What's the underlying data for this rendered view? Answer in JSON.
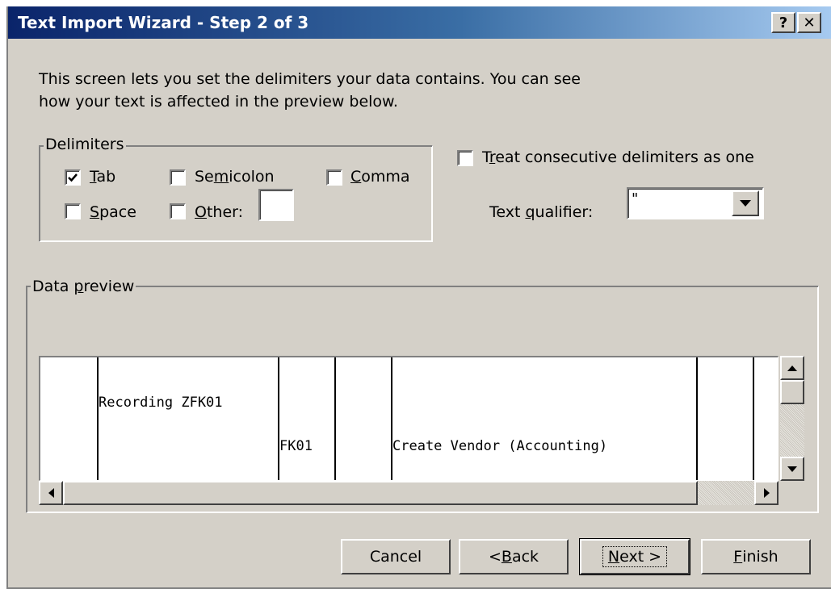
{
  "window": {
    "title": "Text Import Wizard - Step 2 of 3",
    "help_label": "?",
    "close_label": "✕"
  },
  "intro": {
    "line1": "This screen lets you set the delimiters your data contains.  You can see",
    "line2": "how your text is affected in the preview below."
  },
  "delimiters": {
    "legend": "Delimiters",
    "tab": {
      "accel": "T",
      "rest": "ab",
      "checked": true
    },
    "semicolon": {
      "pre": "Se",
      "accel": "m",
      "rest": "icolon",
      "checked": false
    },
    "comma": {
      "accel": "C",
      "rest": "omma",
      "checked": false
    },
    "space": {
      "accel": "S",
      "rest": "pace",
      "checked": false
    },
    "other": {
      "accel": "O",
      "rest": "ther:",
      "checked": false,
      "value": ""
    }
  },
  "consecutive": {
    "pre": "T",
    "accel": "r",
    "rest": "eat consecutive delimiters as one",
    "checked": false
  },
  "qualifier": {
    "pre": "Text ",
    "accel": "q",
    "rest": "ualifier:",
    "value": "\""
  },
  "preview": {
    "legend_pre": "Data ",
    "legend_accel": "p",
    "legend_rest": "review",
    "rows": [
      {
        "col2": "Recording ZFK01",
        "col3": "",
        "col5": ""
      },
      {
        "col2": "",
        "col3": "FK01",
        "col5": "Create Vendor (Accounting)"
      }
    ]
  },
  "buttons": {
    "cancel": "Cancel",
    "back_pre": "< ",
    "back_accel": "B",
    "back_rest": "ack",
    "next_accel": "N",
    "next_rest": "ext >",
    "finish_accel": "F",
    "finish_rest": "inish"
  },
  "icons": {
    "help": "question-mark-icon",
    "close": "close-icon",
    "dropdown": "chevron-down-icon",
    "scroll_up": "arrow-up-icon",
    "scroll_down": "arrow-down-icon",
    "scroll_left": "arrow-left-icon",
    "scroll_right": "arrow-right-icon"
  }
}
